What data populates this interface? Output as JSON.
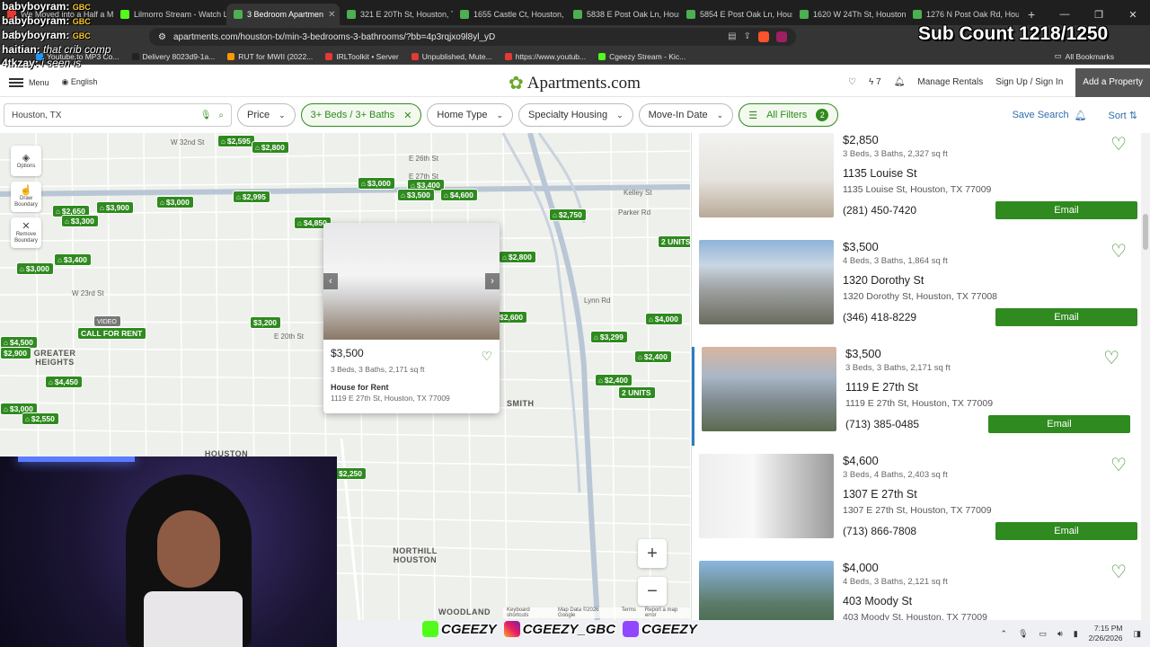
{
  "browser": {
    "tabs": [
      {
        "title": "We Moved into a Half a M",
        "active": false
      },
      {
        "title": "Lilmorro Stream - Watch L",
        "active": false
      },
      {
        "title": "3 Bedroom Apartmen",
        "active": true
      },
      {
        "title": "321 E 20Th St, Houston, T",
        "active": false
      },
      {
        "title": "1655 Castle Ct, Houston, T",
        "active": false
      },
      {
        "title": "5838 E Post Oak Ln, Houst",
        "active": false
      },
      {
        "title": "5854 E Post Oak Ln, Houst",
        "active": false
      },
      {
        "title": "1620 W 24Th St, Houston",
        "active": false
      },
      {
        "title": "1276 N Post Oak Rd, Hou",
        "active": false
      }
    ],
    "url": "apartments.com/houston-tx/min-3-bedrooms-3-bathrooms/?bb=4p3rqjxo9l8yl_yD",
    "bookmarks": [
      "Youtube to MP3 Co...",
      "Delivery 8023d9-1a...",
      "RUT for MWII (2022...",
      "IRLToolkit • Server",
      "Unpublished, Mute...",
      "https://www.youtub...",
      "Cgeezy Stream - Kic..."
    ],
    "all_bookmarks": "All Bookmarks"
  },
  "header": {
    "menu": "Menu",
    "language": "English",
    "logo": "Apartments.com",
    "notifications_count": "7",
    "manage_rentals": "Manage Rentals",
    "sign_up": "Sign Up",
    "sign_in": "Sign In",
    "add_property": "Add a Property"
  },
  "filters": {
    "search_value": "Houston, TX",
    "price": "Price",
    "beds_baths": "3+ Beds / 3+ Baths",
    "home_type": "Home Type",
    "specialty": "Specialty Housing",
    "move_in": "Move-In Date",
    "all_filters": "All Filters",
    "all_filters_count": "2",
    "save_search": "Save Search",
    "sort": "Sort"
  },
  "map": {
    "tools": {
      "options": "Options",
      "draw": "Draw Boundary",
      "remove": "Remove Boundary"
    },
    "labels": {
      "greater_heights": "GREATER HEIGHTS",
      "houston_heights": "HOUSTON HEIGHTS",
      "smith": "SMITH",
      "northill": "NORTHILL HOUSTON",
      "woodland": "WOODLAND",
      "w32": "W 32nd St",
      "e26": "E 26th St",
      "e27": "E 27th St",
      "w23": "W 23rd St",
      "e20": "E 20th St",
      "kelley": "Kelley St",
      "parker": "Parker Rd",
      "lynn": "Lynn Rd",
      "video": "VIDEO",
      "call": "CALL FOR RENT",
      "units1": "2 UNITS",
      "units2": "2 UNITS"
    },
    "pins": [
      "$2,595",
      "$2,800",
      "$3,000",
      "$3,400",
      "$3,500",
      "$4,600",
      "$2,995",
      "$3,000",
      "$3,900",
      "$2,650",
      "$3,300",
      "$4,850",
      "$2,750",
      "$2,800",
      "$3,400",
      "$3,000",
      "$4,500",
      "$2,900",
      "$3,200",
      "$2,600",
      "$3,299",
      "$4,000",
      "$2,400",
      "$2,400",
      "$4,450",
      "$3,000",
      "$2,550",
      "$2,250"
    ],
    "zoom_in": "+",
    "zoom_out": "−",
    "footer": [
      "Keyboard shortcuts",
      "Map Data ©2026 Google",
      "Terms",
      "Report a map error"
    ],
    "popup": {
      "price": "$3,500",
      "specs": "3 Beds, 3 Baths, 2,171 sq ft",
      "type": "House for Rent",
      "address": "1119 E 27th St, Houston, TX 77009"
    }
  },
  "listings": [
    {
      "price": "$2,850",
      "specs": "3 Beds, 3 Baths, 2,327 sq ft",
      "name": "1135 Louise St",
      "address": "1135 Louise St, Houston, TX 77009",
      "phone": "(281) 450-7420",
      "email": "Email",
      "selected": false
    },
    {
      "price": "$3,500",
      "specs": "4 Beds, 3 Baths, 1,864 sq ft",
      "name": "1320 Dorothy St",
      "address": "1320 Dorothy St, Houston, TX 77008",
      "phone": "(346) 418-8229",
      "email": "Email",
      "selected": false
    },
    {
      "price": "$3,500",
      "specs": "3 Beds, 3 Baths, 2,171 sq ft",
      "name": "1119 E 27th St",
      "address": "1119 E 27th St, Houston, TX 77009",
      "phone": "(713) 385-0485",
      "email": "Email",
      "selected": true
    },
    {
      "price": "$4,600",
      "specs": "3 Beds, 4 Baths, 2,403 sq ft",
      "name": "1307 E 27th St",
      "address": "1307 E 27th St, Houston, TX 77009",
      "phone": "(713) 866-7808",
      "email": "Email",
      "selected": false
    },
    {
      "price": "$4,000",
      "specs": "4 Beds, 3 Baths, 2,121 sq ft",
      "name": "403 Moody St",
      "address": "403 Moody St, Houston, TX 77009",
      "phone": "",
      "email": "",
      "selected": false
    }
  ],
  "overlay": {
    "sub_count": "Sub Count 1218/1250",
    "chat": [
      {
        "user": "babyboyram:",
        "msg": "",
        "badge": "GBC"
      },
      {
        "user": "babyboyram:",
        "msg": "",
        "badge": "GBC"
      },
      {
        "user": "babyboyram:",
        "msg": "",
        "badge": "GBC"
      },
      {
        "user": "haitian:",
        "msg": "that crib comp",
        "badge": ""
      },
      {
        "user": "4tkzay:",
        "msg": "i seen is",
        "badge": ""
      }
    ],
    "social": [
      "CGEEZY",
      "CGEEZY_GBC",
      "CGEEZY"
    ]
  },
  "taskbar": {
    "time": "7:15 PM",
    "date": "2/26/2026"
  },
  "colors": {
    "brand_green": "#2f8a1f",
    "link_blue": "#2f6db0",
    "selected_border": "#2d7cc1"
  }
}
